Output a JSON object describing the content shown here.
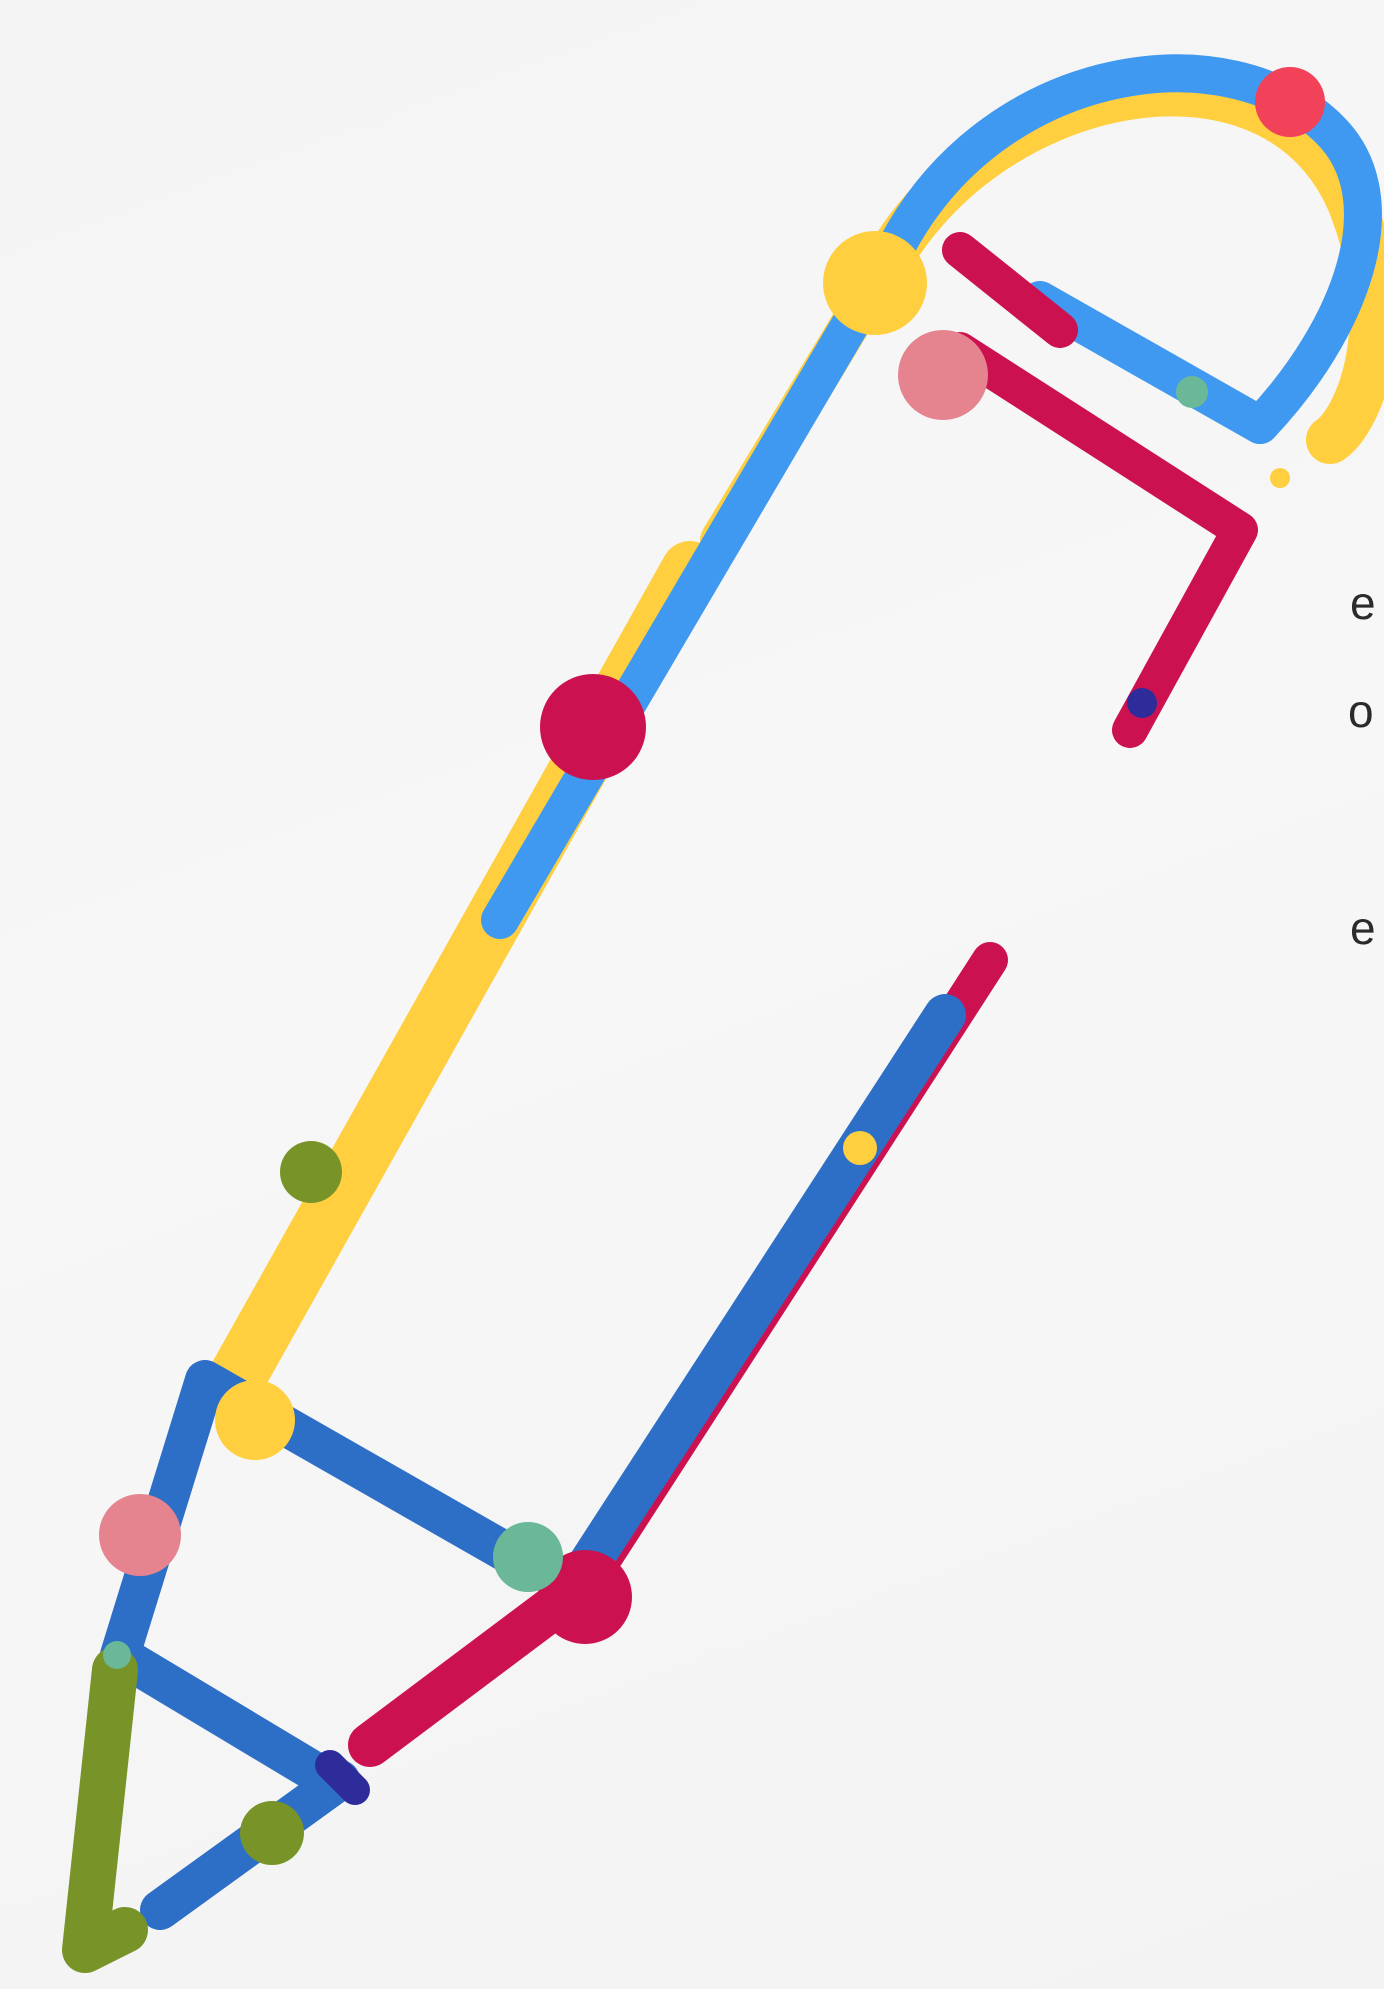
{
  "partial_text": {
    "line1": "e",
    "line2": "o",
    "line3": "e"
  },
  "illustration": {
    "icon": "pencil-icon",
    "colors": {
      "yellow": "#ffcf3f",
      "light_blue": "#3f99f0",
      "crimson": "#cc1150",
      "red_dot": "#f2425a",
      "pink": "#e5838f",
      "teal": "#6ab897",
      "olive": "#789428",
      "navy": "#2e2c9a",
      "royal_blue": "#2d6fc6"
    }
  }
}
